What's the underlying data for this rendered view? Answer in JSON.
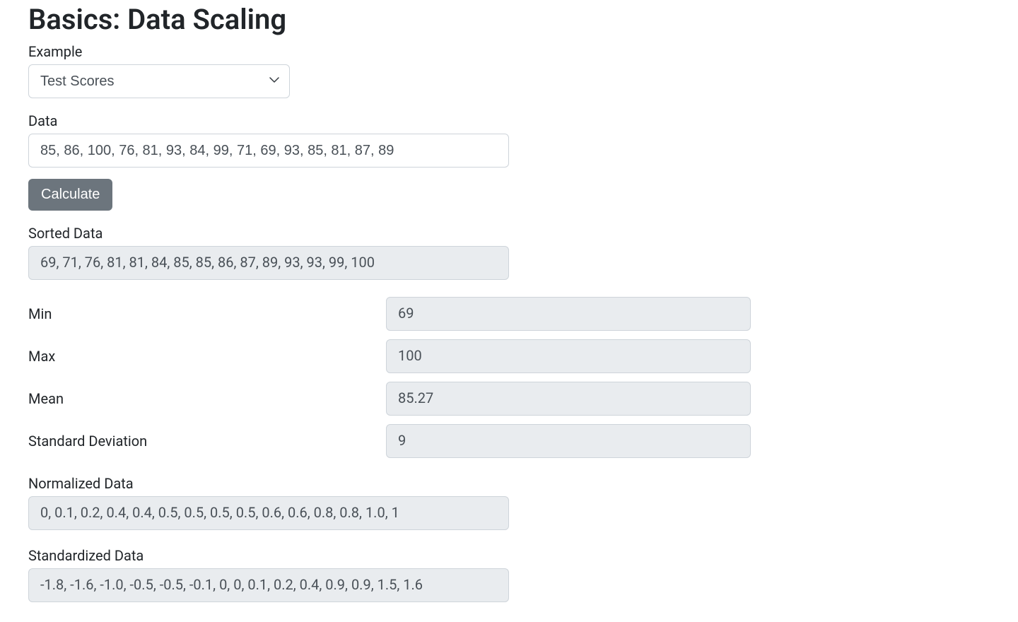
{
  "title": "Basics: Data Scaling",
  "example": {
    "label": "Example",
    "selected": "Test Scores"
  },
  "data": {
    "label": "Data",
    "value": "85, 86, 100, 76, 81, 93, 84, 99, 71, 69, 93, 85, 81, 87, 89"
  },
  "calculate_button": "Calculate",
  "sorted": {
    "label": "Sorted Data",
    "value": "69, 71, 76, 81, 81, 84, 85, 85, 86, 87, 89, 93, 93, 99, 100"
  },
  "stats": {
    "min": {
      "label": "Min",
      "value": "69"
    },
    "max": {
      "label": "Max",
      "value": "100"
    },
    "mean": {
      "label": "Mean",
      "value": "85.27"
    },
    "std": {
      "label": "Standard Deviation",
      "value": "9"
    }
  },
  "normalized": {
    "label": "Normalized Data",
    "value": "0, 0.1, 0.2, 0.4, 0.4, 0.5, 0.5, 0.5, 0.5, 0.6, 0.6, 0.8, 0.8, 1.0, 1"
  },
  "standardized": {
    "label": "Standardized Data",
    "value": "-1.8, -1.6, -1.0, -0.5, -0.5, -0.1, 0, 0, 0.1, 0.2, 0.4, 0.9, 0.9, 1.5, 1.6"
  }
}
